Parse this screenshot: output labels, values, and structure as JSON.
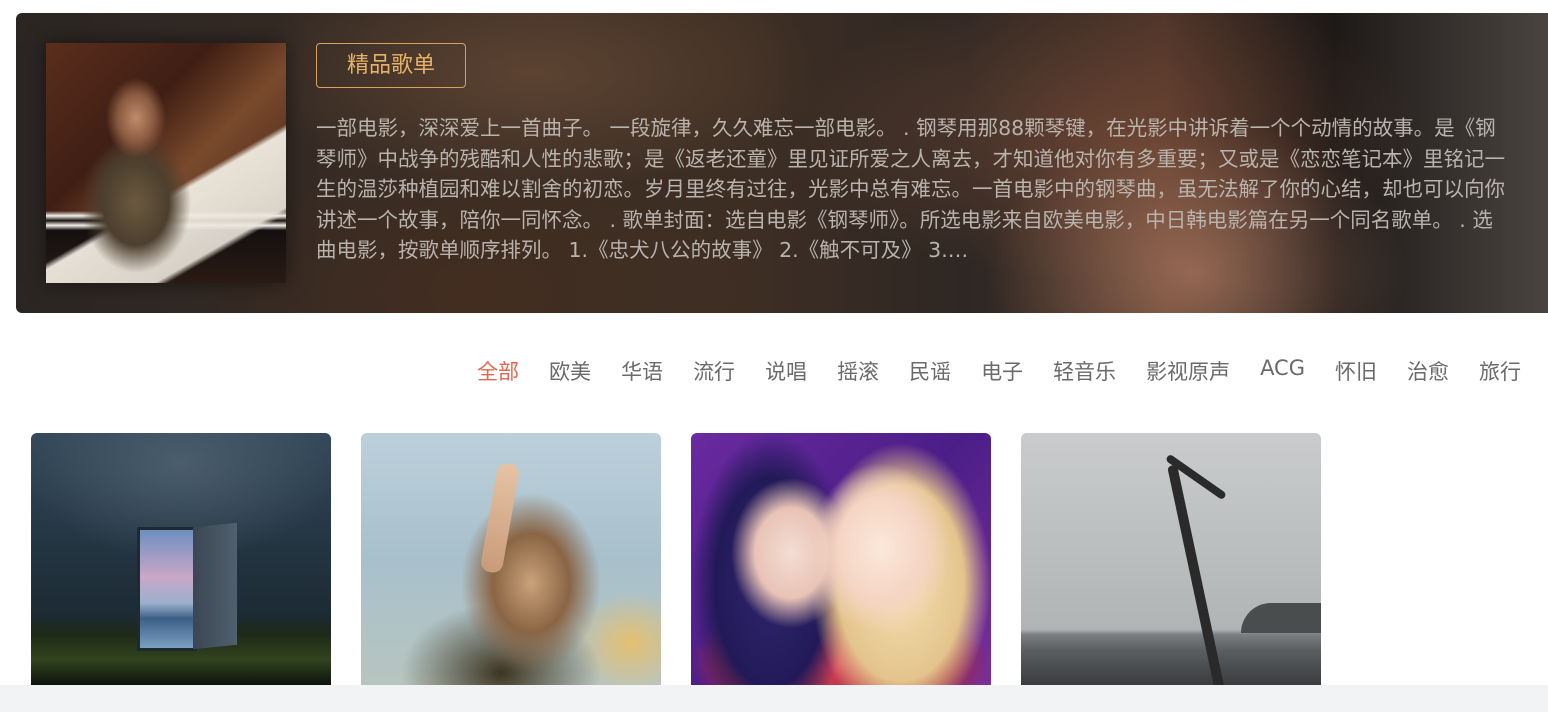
{
  "banner": {
    "tag_label": "精品歌单",
    "cover_alt": "pianist-cover",
    "description": "一部电影，深深爱上一首曲子。 一段旋律，久久难忘一部电影。 . 钢琴用那88颗琴键，在光影中讲诉着一个个动情的故事。是《钢琴师》中战争的残酷和人性的悲歌；是《返老还童》里见证所爱之人离去，才知道他对你有多重要；又或是《恋恋笔记本》里铭记一生的温莎种植园和难以割舍的初恋。岁月里终有过往，光影中总有难忘。一首电影中的钢琴曲，虽无法解了你的心结，却也可以向你讲述一个故事，陪你一同怀念。 . 歌单封面：选自电影《钢琴师》。所选电影来自欧美电影，中日韩电影篇在另一个同名歌单。 . 选曲电影，按歌单顺序排列。 1.《忠犬八公的故事》 2.《触不可及》 3.…"
  },
  "categories": [
    "全部",
    "欧美",
    "华语",
    "流行",
    "说唱",
    "摇滚",
    "民谣",
    "电子",
    "轻音乐",
    "影视原声",
    "ACG",
    "怀旧",
    "治愈",
    "旅行"
  ],
  "active_category": "全部",
  "colors": {
    "accent": "#e0674f",
    "tag_border": "#d6a25c",
    "category_text": "#6a6a6a"
  }
}
